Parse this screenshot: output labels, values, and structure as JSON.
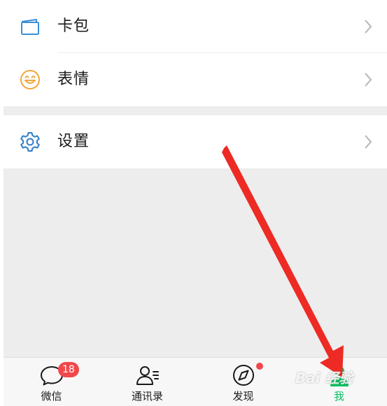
{
  "menu_groups": [
    {
      "items": [
        {
          "label": "卡包",
          "icon": "card-wallet-icon"
        },
        {
          "label": "表情",
          "icon": "smiley-icon"
        }
      ]
    },
    {
      "items": [
        {
          "label": "设置",
          "icon": "gear-icon"
        }
      ]
    }
  ],
  "tabbar": {
    "tabs": [
      {
        "label": "微信",
        "icon": "chat-bubble-icon",
        "badge": "18"
      },
      {
        "label": "通讯录",
        "icon": "contacts-icon"
      },
      {
        "label": "发现",
        "icon": "compass-icon",
        "dot": true
      },
      {
        "label": "我",
        "icon": "person-icon",
        "active": true
      }
    ]
  },
  "watermark": "Bai 经验",
  "colors": {
    "accent": "#07c160",
    "badge": "#f0484b",
    "card_icon": "#3a8fd6",
    "smiley_icon": "#f0a73a",
    "gear_icon": "#2f7ec7",
    "annotation_arrow": "#ee2a24"
  }
}
